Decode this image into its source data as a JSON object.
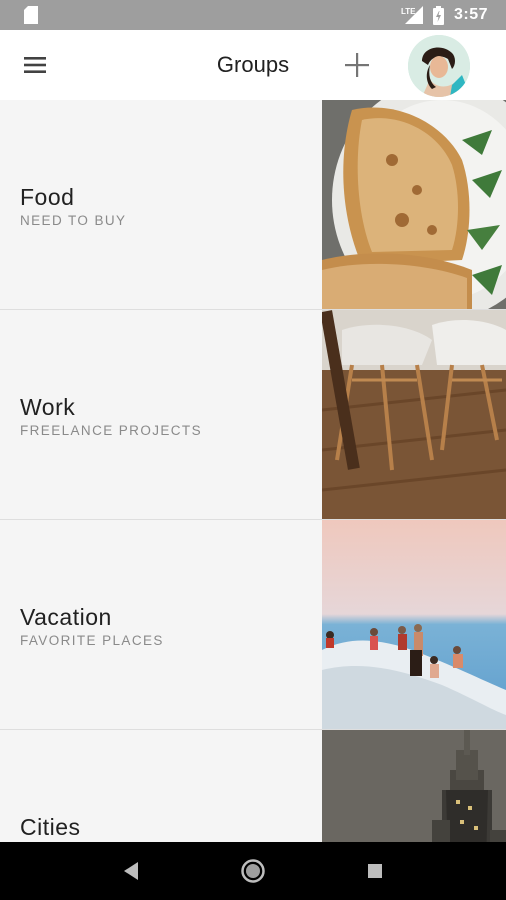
{
  "status_bar": {
    "time": "3:57",
    "network": "LTE"
  },
  "app_bar": {
    "title": "Groups",
    "menu_icon": "hamburger-menu-icon",
    "add_icon": "plus-icon",
    "avatar": "user-avatar"
  },
  "groups": [
    {
      "name": "Food",
      "subtitle": "NEED TO BUY",
      "thumbnail": "toast-photo"
    },
    {
      "name": "Work",
      "subtitle": "FREELANCE PROJECTS",
      "thumbnail": "chairs-photo"
    },
    {
      "name": "Vacation",
      "subtitle": "FAVORITE PLACES",
      "thumbnail": "cliff-people-photo"
    },
    {
      "name": "Cities",
      "subtitle": "",
      "thumbnail": "skyscraper-photo"
    }
  ],
  "nav_bar": {
    "back_icon": "back-triangle-icon",
    "home_icon": "home-circle-icon",
    "recents_icon": "recents-square-icon"
  },
  "colors": {
    "status_bar": "#9e9e9e",
    "app_bar": "#ffffff",
    "list_bg": "#f5f5f5",
    "nav_bar": "#000000"
  }
}
